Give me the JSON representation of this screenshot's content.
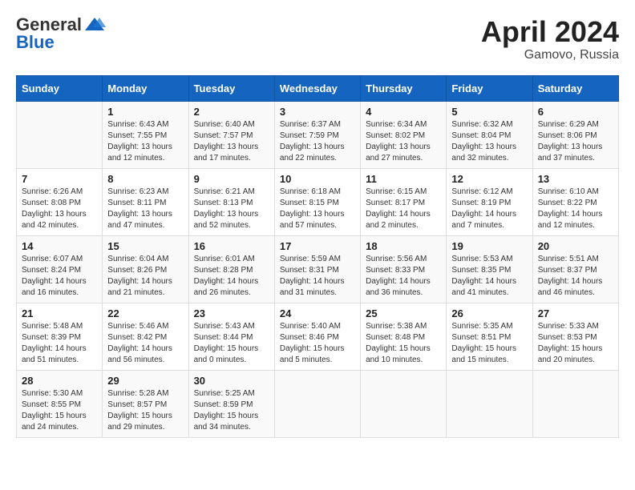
{
  "header": {
    "logo_general": "General",
    "logo_blue": "Blue",
    "month_title": "April 2024",
    "location": "Gamovo, Russia"
  },
  "days_of_week": [
    "Sunday",
    "Monday",
    "Tuesday",
    "Wednesday",
    "Thursday",
    "Friday",
    "Saturday"
  ],
  "weeks": [
    [
      {
        "day": "",
        "info": ""
      },
      {
        "day": "1",
        "info": "Sunrise: 6:43 AM\nSunset: 7:55 PM\nDaylight: 13 hours\nand 12 minutes."
      },
      {
        "day": "2",
        "info": "Sunrise: 6:40 AM\nSunset: 7:57 PM\nDaylight: 13 hours\nand 17 minutes."
      },
      {
        "day": "3",
        "info": "Sunrise: 6:37 AM\nSunset: 7:59 PM\nDaylight: 13 hours\nand 22 minutes."
      },
      {
        "day": "4",
        "info": "Sunrise: 6:34 AM\nSunset: 8:02 PM\nDaylight: 13 hours\nand 27 minutes."
      },
      {
        "day": "5",
        "info": "Sunrise: 6:32 AM\nSunset: 8:04 PM\nDaylight: 13 hours\nand 32 minutes."
      },
      {
        "day": "6",
        "info": "Sunrise: 6:29 AM\nSunset: 8:06 PM\nDaylight: 13 hours\nand 37 minutes."
      }
    ],
    [
      {
        "day": "7",
        "info": "Sunrise: 6:26 AM\nSunset: 8:08 PM\nDaylight: 13 hours\nand 42 minutes."
      },
      {
        "day": "8",
        "info": "Sunrise: 6:23 AM\nSunset: 8:11 PM\nDaylight: 13 hours\nand 47 minutes."
      },
      {
        "day": "9",
        "info": "Sunrise: 6:21 AM\nSunset: 8:13 PM\nDaylight: 13 hours\nand 52 minutes."
      },
      {
        "day": "10",
        "info": "Sunrise: 6:18 AM\nSunset: 8:15 PM\nDaylight: 13 hours\nand 57 minutes."
      },
      {
        "day": "11",
        "info": "Sunrise: 6:15 AM\nSunset: 8:17 PM\nDaylight: 14 hours\nand 2 minutes."
      },
      {
        "day": "12",
        "info": "Sunrise: 6:12 AM\nSunset: 8:19 PM\nDaylight: 14 hours\nand 7 minutes."
      },
      {
        "day": "13",
        "info": "Sunrise: 6:10 AM\nSunset: 8:22 PM\nDaylight: 14 hours\nand 12 minutes."
      }
    ],
    [
      {
        "day": "14",
        "info": "Sunrise: 6:07 AM\nSunset: 8:24 PM\nDaylight: 14 hours\nand 16 minutes."
      },
      {
        "day": "15",
        "info": "Sunrise: 6:04 AM\nSunset: 8:26 PM\nDaylight: 14 hours\nand 21 minutes."
      },
      {
        "day": "16",
        "info": "Sunrise: 6:01 AM\nSunset: 8:28 PM\nDaylight: 14 hours\nand 26 minutes."
      },
      {
        "day": "17",
        "info": "Sunrise: 5:59 AM\nSunset: 8:31 PM\nDaylight: 14 hours\nand 31 minutes."
      },
      {
        "day": "18",
        "info": "Sunrise: 5:56 AM\nSunset: 8:33 PM\nDaylight: 14 hours\nand 36 minutes."
      },
      {
        "day": "19",
        "info": "Sunrise: 5:53 AM\nSunset: 8:35 PM\nDaylight: 14 hours\nand 41 minutes."
      },
      {
        "day": "20",
        "info": "Sunrise: 5:51 AM\nSunset: 8:37 PM\nDaylight: 14 hours\nand 46 minutes."
      }
    ],
    [
      {
        "day": "21",
        "info": "Sunrise: 5:48 AM\nSunset: 8:39 PM\nDaylight: 14 hours\nand 51 minutes."
      },
      {
        "day": "22",
        "info": "Sunrise: 5:46 AM\nSunset: 8:42 PM\nDaylight: 14 hours\nand 56 minutes."
      },
      {
        "day": "23",
        "info": "Sunrise: 5:43 AM\nSunset: 8:44 PM\nDaylight: 15 hours\nand 0 minutes."
      },
      {
        "day": "24",
        "info": "Sunrise: 5:40 AM\nSunset: 8:46 PM\nDaylight: 15 hours\nand 5 minutes."
      },
      {
        "day": "25",
        "info": "Sunrise: 5:38 AM\nSunset: 8:48 PM\nDaylight: 15 hours\nand 10 minutes."
      },
      {
        "day": "26",
        "info": "Sunrise: 5:35 AM\nSunset: 8:51 PM\nDaylight: 15 hours\nand 15 minutes."
      },
      {
        "day": "27",
        "info": "Sunrise: 5:33 AM\nSunset: 8:53 PM\nDaylight: 15 hours\nand 20 minutes."
      }
    ],
    [
      {
        "day": "28",
        "info": "Sunrise: 5:30 AM\nSunset: 8:55 PM\nDaylight: 15 hours\nand 24 minutes."
      },
      {
        "day": "29",
        "info": "Sunrise: 5:28 AM\nSunset: 8:57 PM\nDaylight: 15 hours\nand 29 minutes."
      },
      {
        "day": "30",
        "info": "Sunrise: 5:25 AM\nSunset: 8:59 PM\nDaylight: 15 hours\nand 34 minutes."
      },
      {
        "day": "",
        "info": ""
      },
      {
        "day": "",
        "info": ""
      },
      {
        "day": "",
        "info": ""
      },
      {
        "day": "",
        "info": ""
      }
    ]
  ]
}
